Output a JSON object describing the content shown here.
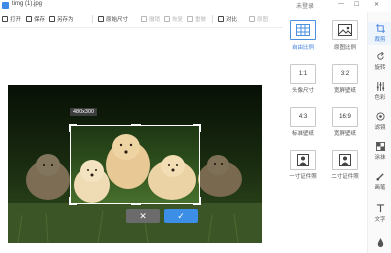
{
  "window": {
    "title": "timg (1).jpg",
    "login": "未登录",
    "min": "—",
    "max": "☐",
    "close": "✕"
  },
  "toolbar": {
    "open": "打开",
    "save": "保存",
    "save_as": "另存为",
    "original_size": "原始尺寸",
    "undo": "撤销",
    "redo": "恢复",
    "reset": "重做",
    "compare": "对比",
    "mosaic": "原图"
  },
  "image": {
    "size_label": "480x300"
  },
  "crop_actions": {
    "cancel": "✕",
    "confirm": "✓"
  },
  "colors": {
    "accent": "#3d8ee6",
    "cancel": "#6b6b6b"
  },
  "ratios": [
    {
      "icon": "grid-icon",
      "label": "自由比例",
      "active": true
    },
    {
      "icon": "image-icon",
      "label": "原图比例",
      "active": false
    },
    {
      "glyph": "1:1",
      "label": "头像尺寸",
      "active": false
    },
    {
      "glyph": "3:2",
      "label": "宽屏壁纸",
      "active": false
    },
    {
      "glyph": "4:3",
      "label": "标准壁纸",
      "active": false
    },
    {
      "glyph": "16:9",
      "label": "宽屏壁纸",
      "active": false
    },
    {
      "icon": "person-icon",
      "label": "一寸证件照",
      "active": false
    },
    {
      "icon": "person-icon",
      "label": "二寸证件照",
      "active": false
    }
  ],
  "rail": [
    {
      "label": "裁剪",
      "active": true
    },
    {
      "label": "旋转",
      "active": false
    },
    {
      "label": "色彩",
      "active": false
    },
    {
      "label": "滤镜",
      "active": false
    },
    {
      "label": "涂抹",
      "active": false
    },
    {
      "label": "画笔",
      "active": false
    },
    {
      "label": "文字",
      "active": false
    },
    {
      "label": "",
      "active": false
    }
  ]
}
